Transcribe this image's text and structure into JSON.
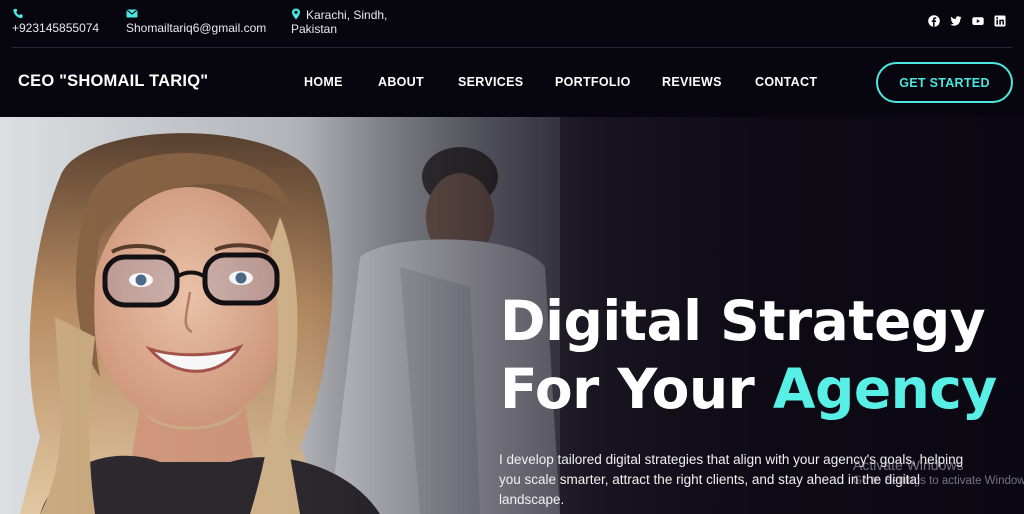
{
  "topbar": {
    "phone": "+923145855074",
    "email": "Shomailtariq6@gmail.com",
    "location_line1": "Karachi, Sindh,",
    "location_line2": "Pakistan",
    "icons": [
      "phone-icon",
      "envelope-icon",
      "map-pin-icon"
    ],
    "social_icons": [
      "facebook-icon",
      "twitter-icon",
      "youtube-icon",
      "linkedin-icon"
    ]
  },
  "navbar": {
    "brand": "CEO \"SHOMAIL TARIQ\"",
    "items": [
      {
        "label": "HOME"
      },
      {
        "label": "ABOUT"
      },
      {
        "label": "SERVICES"
      },
      {
        "label": "PORTFOLIO"
      },
      {
        "label": "REVIEWS"
      },
      {
        "label": "CONTACT"
      }
    ],
    "cta_label": "GET STARTED"
  },
  "hero": {
    "title_line1": "Digital Strategy",
    "title_line2_prefix": "For Your ",
    "title_line2_accent": "Agency",
    "description": "I develop tailored digital strategies that align with your agency's goals, helping you scale smarter, attract the right clients, and stay ahead in the digital landscape."
  },
  "watermark": {
    "title": "Activate Windows",
    "subtitle": "Go to Settings to activate Windows."
  },
  "colors": {
    "accent": "#4ee6e0",
    "background": "#07050d"
  }
}
